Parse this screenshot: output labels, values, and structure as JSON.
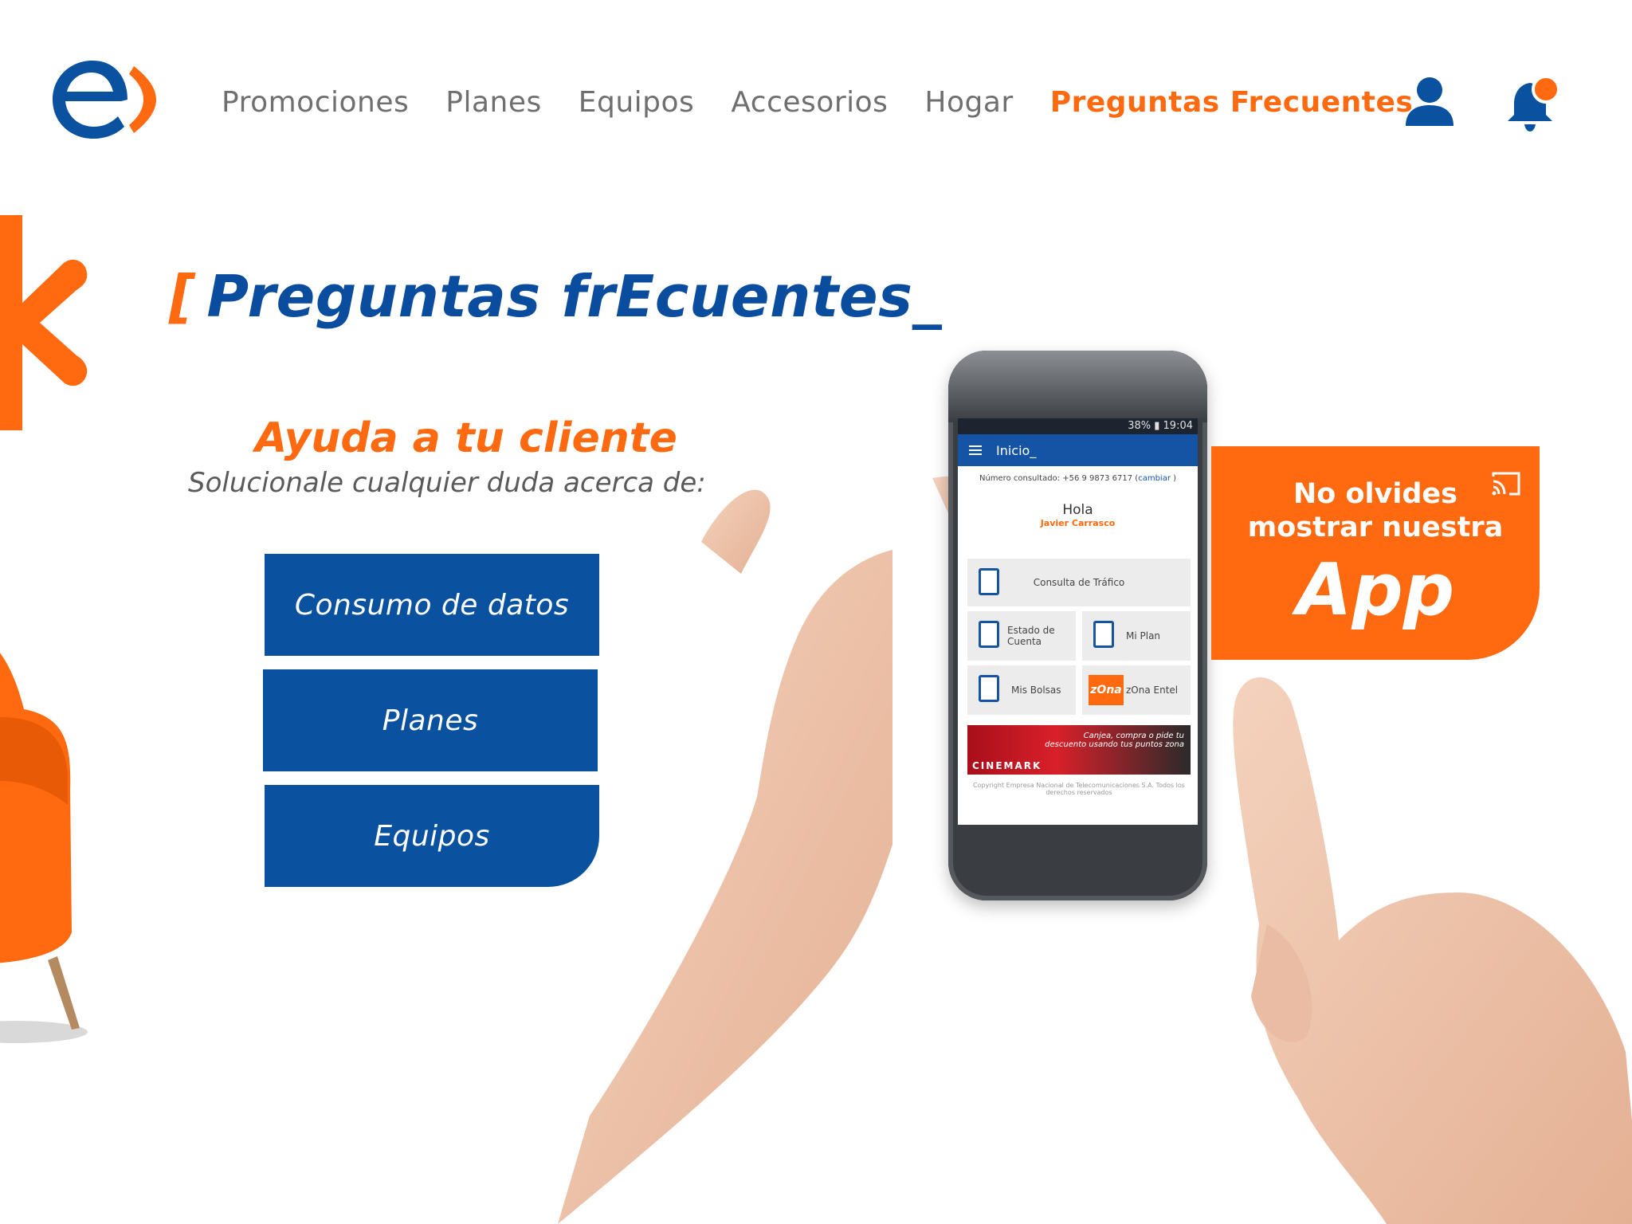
{
  "brand": {
    "logo_name": "entel-logo",
    "primary_color": "#0a52a0",
    "accent_color": "#ff6a10"
  },
  "nav": {
    "items": [
      "Promociones",
      "Planes",
      "Equipos",
      "Accesorios",
      "Hogar"
    ],
    "active": "Preguntas Frecuentes"
  },
  "header_icons": {
    "user": "user-icon",
    "bell": "bell-icon"
  },
  "hero": {
    "bracket": "[",
    "title": "Preguntas frEcuentes_"
  },
  "help": {
    "heading": "Ayuda a tu cliente",
    "subtitle": "Solucionale cualquier duda acerca de:"
  },
  "buttons": [
    "Consumo de datos",
    "Planes",
    "Equipos"
  ],
  "phone": {
    "status_time": "38% ▮ 19:04",
    "app_title": "Inicio_",
    "number_line": "Número consultado: +56 9 9873 6717 (",
    "change_link": "cambiar",
    "number_line_end": " )",
    "greeting": "Hola",
    "user_name": "Javier Carrasco",
    "tiles": [
      "Consulta de Tráfico",
      "Estado de Cuenta",
      "Mi Plan",
      "Mis Bolsas",
      "zOna Entel"
    ],
    "zona_logo": "zOna",
    "banner_text": "Canjea, compra o pide tu descuento usando tus puntos zona",
    "banner_brand": "CINEMARK",
    "copyright": "Copyright Empresa Nacional de Telecomunicaciones S.A. Todos los derechos reservados"
  },
  "app_card": {
    "line1": "No olvides",
    "line2": "mostrar nuestra",
    "big": "App"
  }
}
